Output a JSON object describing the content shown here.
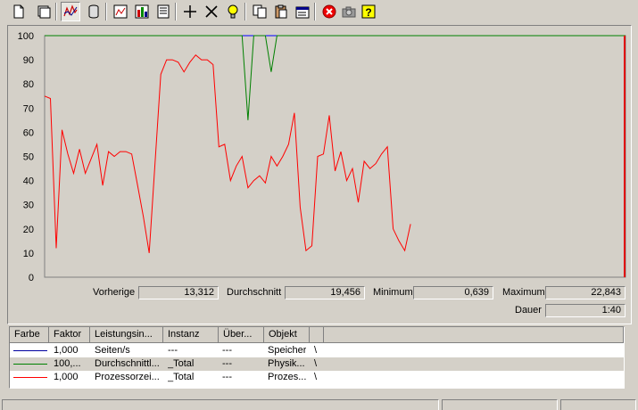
{
  "toolbar": {
    "buttons": [
      "new-counter-set-icon",
      "clear-display-icon",
      "view-graph-icon",
      "view-histogram-icon",
      "view-report-icon",
      "add-counter-icon",
      "delete-counter-icon",
      "highlight-icon",
      "copy-properties-icon",
      "paste-counter-list-icon",
      "properties-icon",
      "freeze-display-icon",
      "update-data-icon",
      "help-icon"
    ]
  },
  "chart_data": {
    "type": "line",
    "ylim": [
      0,
      100
    ],
    "yticks": [
      "100",
      "90",
      "80",
      "70",
      "60",
      "50",
      "40",
      "30",
      "20",
      "10",
      "0"
    ],
    "x_count": 100,
    "time_bar_index": 100,
    "series": [
      {
        "color": "#0000ff",
        "values": [
          100,
          100,
          100,
          100,
          100,
          100,
          100,
          100,
          100,
          100,
          100,
          100,
          100,
          100,
          100,
          100,
          100,
          100,
          100,
          100,
          100,
          100,
          100,
          100,
          100,
          100,
          100,
          100,
          100,
          100,
          100,
          100,
          100,
          100,
          100,
          100,
          100,
          100,
          100,
          100,
          100,
          100,
          100,
          100,
          100,
          100,
          100,
          100,
          100,
          100,
          100,
          100,
          100,
          100,
          100,
          100,
          100,
          100,
          100,
          100,
          100,
          100,
          100,
          100,
          100,
          100,
          100,
          100,
          100,
          100,
          100,
          100,
          100,
          100,
          100,
          100,
          100,
          100,
          100,
          100,
          100,
          100,
          100,
          100,
          100,
          100,
          100,
          100,
          100,
          100,
          100,
          100,
          100,
          100,
          100,
          100,
          100,
          100,
          100,
          100,
          100
        ]
      },
      {
        "color": "#008000",
        "values": [
          100,
          100,
          100,
          100,
          100,
          100,
          100,
          100,
          100,
          100,
          100,
          100,
          100,
          100,
          100,
          100,
          100,
          100,
          100,
          100,
          100,
          100,
          100,
          100,
          100,
          100,
          100,
          100,
          100,
          100,
          100,
          100,
          100,
          100,
          100,
          65,
          100,
          100,
          100,
          85,
          100,
          100,
          100,
          100,
          100,
          100,
          100,
          100,
          100,
          100,
          100,
          100,
          100,
          100,
          100,
          100,
          100,
          100,
          100,
          100,
          100,
          100,
          100,
          100,
          100,
          100,
          100,
          100,
          100,
          100,
          100,
          100,
          100,
          100,
          100,
          100,
          100,
          100,
          100,
          100,
          100,
          100,
          100,
          100,
          100,
          100,
          100,
          100,
          100,
          100,
          100,
          100,
          100,
          100,
          100,
          100,
          100,
          100,
          100,
          100,
          100
        ]
      },
      {
        "color": "#ff0000",
        "values": [
          75,
          74,
          12,
          61,
          51,
          43,
          53,
          43,
          49,
          55,
          38,
          52,
          50,
          52,
          52,
          51,
          38,
          25,
          10,
          47,
          84,
          90,
          90,
          89,
          85,
          89,
          92,
          90,
          90,
          88,
          54,
          55,
          40,
          46,
          50,
          37,
          40,
          42,
          39,
          50,
          46,
          50,
          55,
          68,
          29,
          11,
          13,
          50,
          51,
          67,
          44,
          52,
          40,
          45,
          31,
          48,
          45,
          47,
          51,
          54,
          20,
          15,
          11,
          22
        ]
      }
    ]
  },
  "stats": {
    "last_label": "Vorherige",
    "last_value": "13,312",
    "avg_label": "Durchschnitt",
    "avg_value": "19,456",
    "min_label": "Minimum",
    "min_value": "0,639",
    "max_label": "Maximum",
    "max_value": "22,843",
    "dur_label": "Dauer",
    "dur_value": "1:40"
  },
  "legend": {
    "headers": [
      "Farbe",
      "Faktor",
      "Leistungsin...",
      "Instanz",
      "Über...",
      "Objekt"
    ],
    "rows": [
      {
        "color": "#0000a0",
        "faktor": "1,000",
        "counter": "Seiten/s",
        "instanz": "---",
        "ueber": "---",
        "objekt": "Speicher",
        "path": "\\"
      },
      {
        "color": "#008000",
        "faktor": "100,...",
        "counter": "Durchschnittl...",
        "instanz": "_Total",
        "ueber": "---",
        "objekt": "Physik...",
        "path": "\\"
      },
      {
        "color": "#ff0000",
        "faktor": "1,000",
        "counter": "Prozessorzei...",
        "instanz": "_Total",
        "ueber": "---",
        "objekt": "Prozes...",
        "path": "\\"
      }
    ]
  }
}
